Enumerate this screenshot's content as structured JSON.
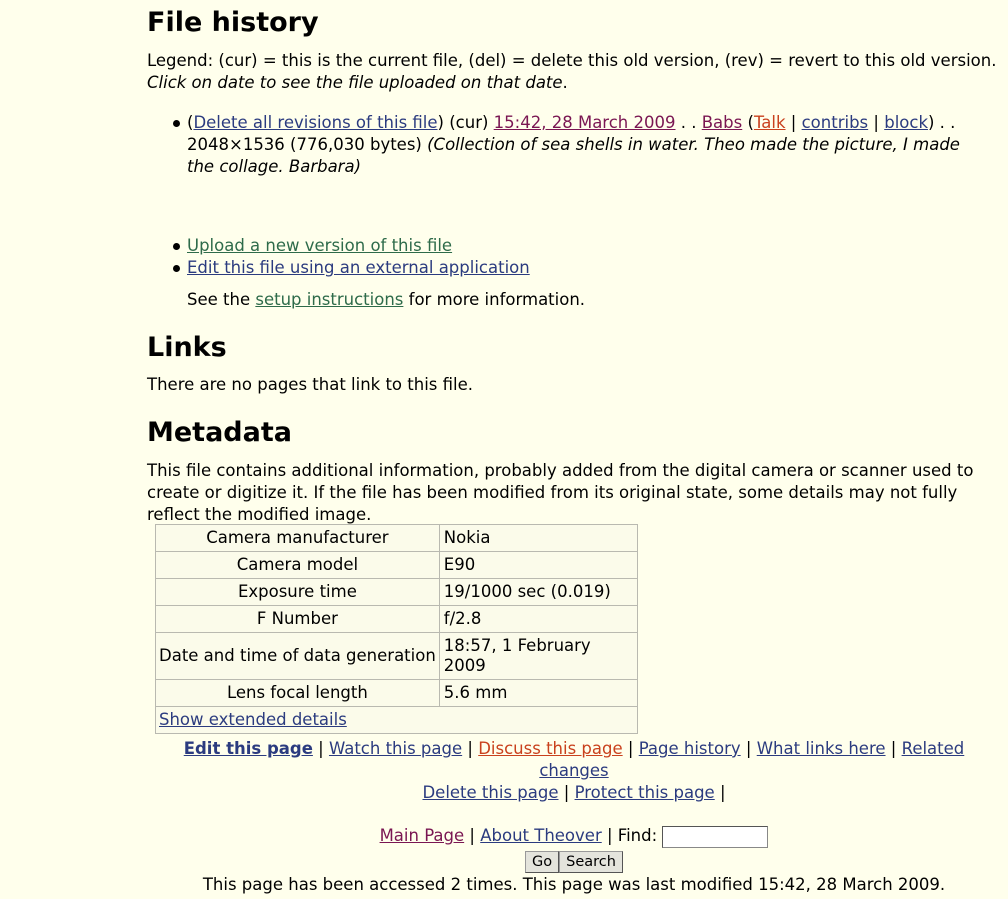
{
  "file_history": {
    "heading": "File history",
    "legend_text": "Legend: (cur) = this is the current file, (del) = delete this old version, (rev) = revert to this old version.",
    "hint_text": "Click on date to see the file uploaded on that date",
    "entry": {
      "open_paren": "(",
      "delete_all_link": "Delete all revisions of this file",
      "cur_text": ") (cur) ",
      "date_link": "15:42, 28 March 2009",
      "sep": " . . ",
      "user_link": "Babs",
      "talk_link": "Talk",
      "contribs_link": "contribs",
      "block_link": "block",
      "close_sep": ") . .",
      "dimensions": "2048×1536 (776,030 bytes)",
      "comment": "(Collection of sea shells in water. Theo made the picture, I made the collage. Barbara)"
    },
    "actions": {
      "upload_link": "Upload a new version of this file",
      "edit_external_link": "Edit this file using an external application",
      "setup_prefix": "See the ",
      "setup_link": "setup instructions",
      "setup_suffix": " for more information."
    }
  },
  "links": {
    "heading": "Links",
    "text": "There are no pages that link to this file."
  },
  "metadata": {
    "heading": "Metadata",
    "intro": "This file contains additional information, probably added from the digital camera or scanner used to create or digitize it. If the file has been modified from its original state, some details may not fully reflect the modified image.",
    "rows": [
      {
        "key": "Camera manufacturer",
        "value": "Nokia"
      },
      {
        "key": "Camera model",
        "value": "E90"
      },
      {
        "key": "Exposure time",
        "value": "19/1000 sec (0.019)"
      },
      {
        "key": "F Number",
        "value": "f/2.8"
      },
      {
        "key": "Date and time of data generation",
        "value": "18:57, 1 February 2009"
      },
      {
        "key": "Lens focal length",
        "value": "5.6 mm"
      }
    ],
    "show_extended": "Show extended details"
  },
  "footer": {
    "edit_page": "Edit this page",
    "watch_page": "Watch this page",
    "discuss_page": "Discuss this page",
    "page_history": "Page history",
    "what_links_here": "What links here",
    "related_changes": "Related changes",
    "delete_page": "Delete this page",
    "protect_page": "Protect this page",
    "main_page": "Main Page",
    "about": "About Theover",
    "find_label": "Find:",
    "go_button": "Go",
    "search_button": "Search",
    "access_text": "This page has been accessed 2 times. This page was last modified 15:42, 28 March 2009."
  },
  "colors": {
    "background": "#ffffec",
    "link": "#2b3b7f",
    "visited_link": "#7a1652",
    "new_link": "#c9411d",
    "green_link": "#2e6b4a"
  }
}
